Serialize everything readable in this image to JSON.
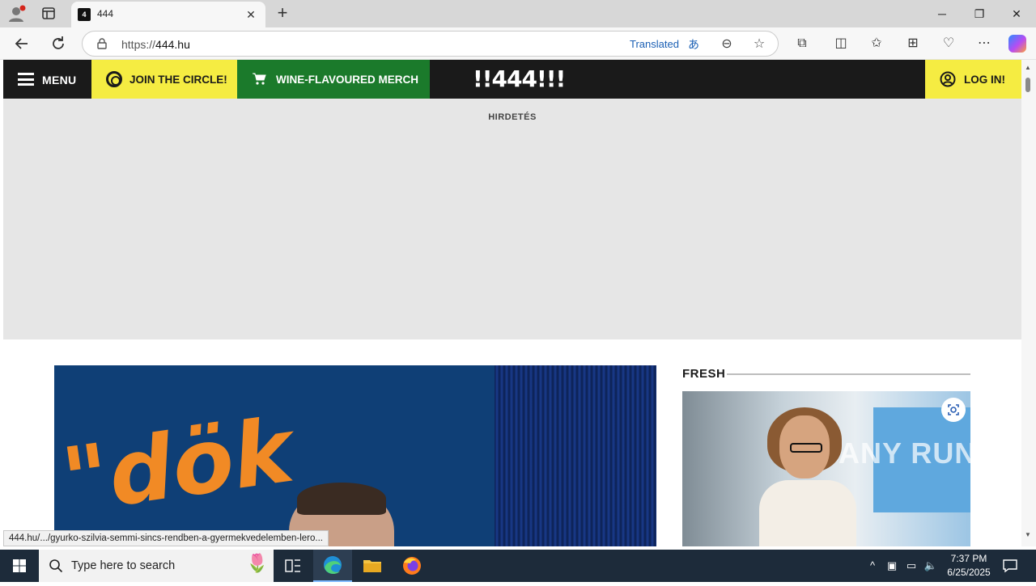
{
  "browser": {
    "tab_title": "444",
    "tab_favicon": "4",
    "url_prefix": "https://",
    "url_host": "444.hu",
    "translated_label": "Translated",
    "status_url": "444.hu/.../gyurko-szilvia-semmi-sincs-rendben-a-gyermekvedelemben-lero..."
  },
  "site": {
    "nav": {
      "menu_label": "MENU",
      "circle_label": "JOIN THE CIRCLE!",
      "merch_label": "WINE-FLAVOURED MERCH",
      "logo_text": "!!444!!!",
      "login_label": "LOG IN!"
    },
    "ad_label": "HIRDETÉS",
    "fresh_title": "FRESH",
    "watermark": "ANY RUN"
  },
  "taskbar": {
    "search_placeholder": "Type here to search",
    "time": "7:37 PM",
    "date": "6/25/2025"
  },
  "colors": {
    "nav_bg": "#1a1a1a",
    "yellow": "#f5ec42",
    "green": "#1b7a2b",
    "ad_bg": "#e6e6e6"
  }
}
